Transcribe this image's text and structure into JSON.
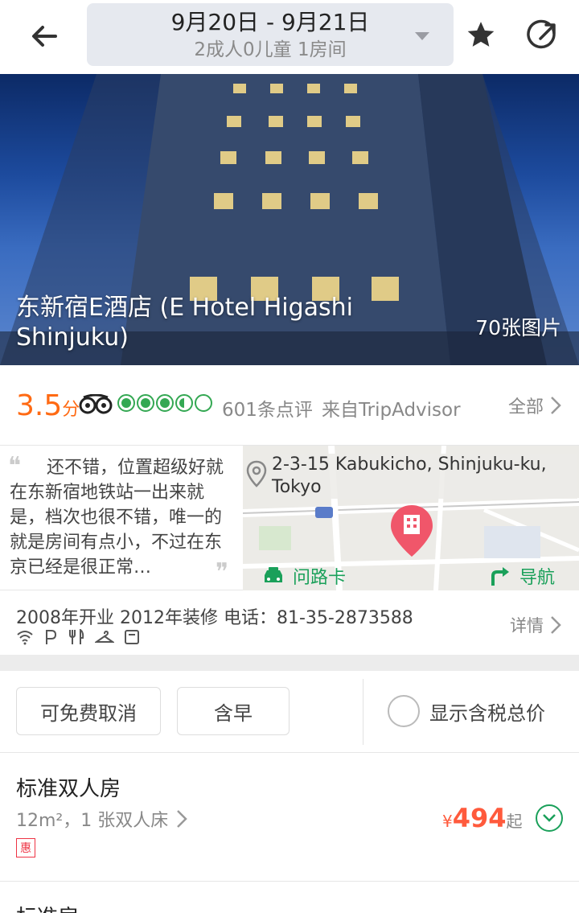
{
  "header": {
    "date_range": "9月20日 - 9月21日",
    "guests": "2成人0儿童 1房间"
  },
  "hero": {
    "hotel_name": "东新宿E酒店 (E Hotel Higashi Shinjuku)",
    "photo_count": "70张图片"
  },
  "rating": {
    "score": "3.5",
    "score_unit": "分",
    "bubble_rating": 3.5,
    "review_count": "601条点评",
    "source": "来自TripAdvisor",
    "all_label": "全部"
  },
  "review": {
    "text": "还不错，位置超级好就在东新宿地铁站一出来就是，档次也很不错，唯一的就是房间有点小，不过在东京已经是很正常…"
  },
  "map": {
    "address": "2-3-15 Kabukicho, Shinjuku-ku, Tokyo",
    "card_label": "问路卡",
    "nav_label": "导航",
    "accent_color": "#1aa05a"
  },
  "info": {
    "summary": "2008年开业  2012年装修  电话：81-35-2873588",
    "detail_label": "详情",
    "facility_icons": [
      "wifi-icon",
      "parking-icon",
      "restaurant-icon",
      "hanger-icon",
      "luggage-icon"
    ]
  },
  "filters": {
    "free_cancel": "可免费取消",
    "breakfast": "含早",
    "tax_toggle": "显示含税总价"
  },
  "rooms": [
    {
      "name": "标准双人房",
      "area": "12m²，1 张双人床",
      "promo": "惠",
      "currency": "¥",
      "price": "494",
      "price_suffix": "起"
    },
    {
      "name": "标准房"
    }
  ],
  "colors": {
    "price": "#ff5a3c",
    "score": "#ff6a13",
    "tripadvisor_green": "#34a853"
  }
}
